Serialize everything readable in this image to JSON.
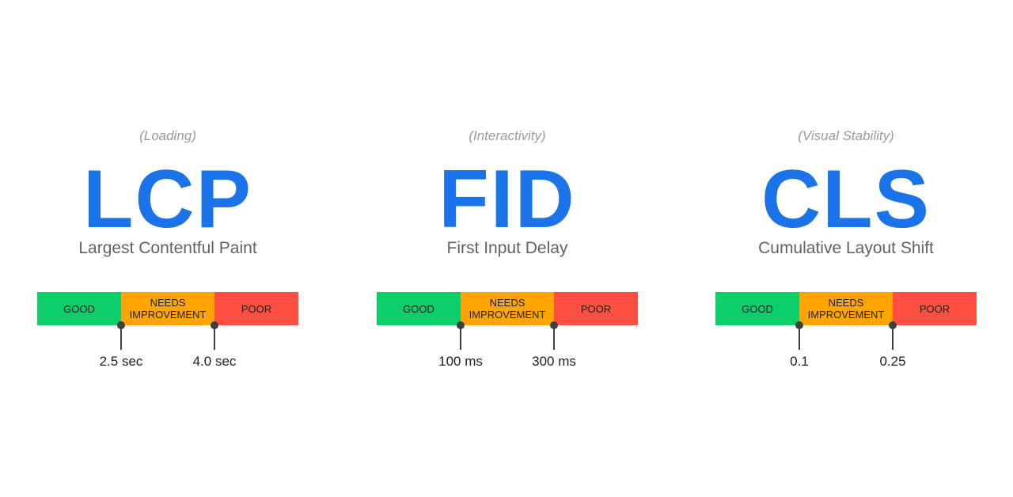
{
  "colors": {
    "accent": "#1a73e8",
    "good": "#0cce6b",
    "needs_improvement": "#ffa400",
    "poor": "#ff4e42"
  },
  "metrics": [
    {
      "category": "(Loading)",
      "abbr": "LCP",
      "name": "Largest Contentful Paint",
      "good": "GOOD",
      "needs": "NEEDS IMPROVEMENT",
      "poor": "POOR",
      "threshold_1": "2.5 sec",
      "threshold_2": "4.0 sec"
    },
    {
      "category": "(Interactivity)",
      "abbr": "FID",
      "name": "First Input Delay",
      "good": "GOOD",
      "needs": "NEEDS IMPROVEMENT",
      "poor": "POOR",
      "threshold_1": "100 ms",
      "threshold_2": "300 ms"
    },
    {
      "category": "(Visual Stability)",
      "abbr": "CLS",
      "name": "Cumulative Layout Shift",
      "good": "GOOD",
      "needs": "NEEDS IMPROVEMENT",
      "poor": "POOR",
      "threshold_1": "0.1",
      "threshold_2": "0.25"
    }
  ]
}
